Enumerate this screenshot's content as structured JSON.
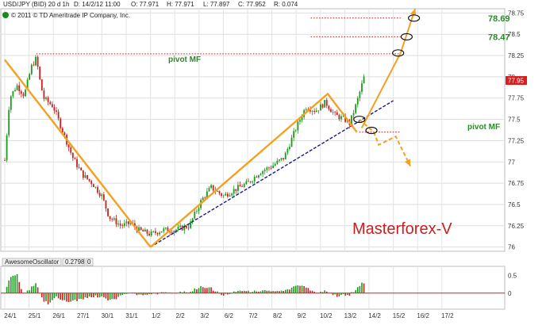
{
  "header": {
    "symbol": "USD/JPY (BID) 20 d 1h",
    "date_field": "D: 14/2/12 11:00",
    "open": "O: 77.971",
    "high": "H: 77.971",
    "low": "L: 77.897",
    "close": "C: 77.952",
    "range": "R: 0.074",
    "copyright": "© 2011 © TD Ameritrade IP Company, Inc."
  },
  "indicator": {
    "name": "AwesomeOscillator",
    "value": "0.2798",
    "param": "0"
  },
  "colors": {
    "up_candle": "#1a9a1a",
    "down_candle": "#c82020",
    "orange_line": "#f5a020",
    "trend_line": "#1a1a80",
    "target_line": "#c81010",
    "current_price_box": "#d42020",
    "label_green": "#2a8a2a",
    "watermark": "#c82020"
  },
  "chart_data": {
    "type": "candlestick",
    "ylim": [
      75.95,
      78.8
    ],
    "yticks": [
      "78.75",
      "78.5",
      "78.25",
      "78",
      "77.75",
      "77.5",
      "77.25",
      "77",
      "76.75",
      "76.5",
      "76.25",
      "76"
    ],
    "current_price": "77.95",
    "dates": [
      "24/1",
      "25/1",
      "26/1",
      "27/1",
      "30/1",
      "31/1",
      "1/2",
      "2/2",
      "3/2",
      "6/2",
      "7/2",
      "8/2",
      "9/2",
      "10/2",
      "13/2",
      "14/2",
      "15/2",
      "16/2",
      "17/2"
    ],
    "price_anchors": [
      {
        "day": 0,
        "price": 77.02
      },
      {
        "day": 0.2,
        "price": 77.75
      },
      {
        "day": 0.5,
        "price": 77.9
      },
      {
        "day": 0.8,
        "price": 77.78
      },
      {
        "day": 1.1,
        "price": 78.12
      },
      {
        "day": 1.3,
        "price": 78.22
      },
      {
        "day": 1.45,
        "price": 77.95
      },
      {
        "day": 1.6,
        "price": 77.75
      },
      {
        "day": 2.0,
        "price": 77.65
      },
      {
        "day": 2.4,
        "price": 77.35
      },
      {
        "day": 2.8,
        "price": 77.05
      },
      {
        "day": 3.2,
        "price": 76.85
      },
      {
        "day": 3.6,
        "price": 76.75
      },
      {
        "day": 4.0,
        "price": 76.6
      },
      {
        "day": 4.3,
        "price": 76.35
      },
      {
        "day": 4.8,
        "price": 76.25
      },
      {
        "day": 5.2,
        "price": 76.28
      },
      {
        "day": 5.5,
        "price": 76.2
      },
      {
        "day": 6.0,
        "price": 76.15
      },
      {
        "day": 6.5,
        "price": 76.2
      },
      {
        "day": 7.0,
        "price": 76.2
      },
      {
        "day": 7.6,
        "price": 76.25
      },
      {
        "day": 8.1,
        "price": 76.55
      },
      {
        "day": 8.5,
        "price": 76.7
      },
      {
        "day": 9.0,
        "price": 76.6
      },
      {
        "day": 9.5,
        "price": 76.68
      },
      {
        "day": 10.0,
        "price": 76.75
      },
      {
        "day": 10.5,
        "price": 76.88
      },
      {
        "day": 11.0,
        "price": 76.95
      },
      {
        "day": 11.5,
        "price": 77.05
      },
      {
        "day": 12.0,
        "price": 77.4
      },
      {
        "day": 12.4,
        "price": 77.65
      },
      {
        "day": 12.8,
        "price": 77.6
      },
      {
        "day": 13.2,
        "price": 77.7
      },
      {
        "day": 13.6,
        "price": 77.55
      },
      {
        "day": 14.0,
        "price": 77.5
      },
      {
        "day": 14.2,
        "price": 77.45
      },
      {
        "day": 14.5,
        "price": 77.7
      },
      {
        "day": 14.8,
        "price": 78.0
      }
    ],
    "pivot_lines": [
      {
        "label": "pivot MF",
        "price": 78.27,
        "day_from": 1.3,
        "day_to": 16.3
      },
      {
        "label": "pivot MF",
        "price": 77.35,
        "day_from": 14.6,
        "day_to": 16.3
      }
    ],
    "targets": [
      {
        "label": "78.69",
        "price": 78.69,
        "day_from": 12.6,
        "day_to": 16.3
      },
      {
        "label": "78.47",
        "price": 78.47,
        "day_from": 12.6,
        "day_to": 16.3
      }
    ],
    "trendline": {
      "from": {
        "day": 6.0,
        "price": 76.0
      },
      "to": {
        "day": 16.0,
        "price": 77.72
      }
    },
    "projection_up": [
      {
        "day": 14.7,
        "price": 77.4
      },
      {
        "day": 16.3,
        "price": 78.28
      },
      {
        "day": 16.9,
        "price": 78.8
      }
    ],
    "projection_down": [
      {
        "day": 14.6,
        "price": 77.5
      },
      {
        "day": 15.2,
        "price": 77.35
      },
      {
        "day": 15.4,
        "price": 77.2
      },
      {
        "day": 16.1,
        "price": 77.3
      },
      {
        "day": 16.7,
        "price": 76.95
      }
    ],
    "wave_lines": [
      [
        {
          "day": 0.0,
          "price": 78.2
        },
        {
          "day": 6.0,
          "price": 76.0
        }
      ],
      [
        {
          "day": 6.0,
          "price": 76.0
        },
        {
          "day": 13.3,
          "price": 77.8
        },
        {
          "day": 14.5,
          "price": 77.35
        }
      ]
    ],
    "markers": [
      {
        "day": 14.6,
        "price": 77.5
      },
      {
        "day": 15.1,
        "price": 77.37
      },
      {
        "day": 16.2,
        "price": 78.28
      },
      {
        "day": 16.55,
        "price": 78.47
      },
      {
        "day": 16.85,
        "price": 78.69
      }
    ],
    "osc_yticks": [
      "0.5",
      "0"
    ],
    "osc_ylim": [
      -0.45,
      0.75
    ]
  },
  "annotations": {
    "pivot_top": "pivot MF",
    "pivot_right": "pivot MF",
    "watermark": "Masterforex-V"
  }
}
